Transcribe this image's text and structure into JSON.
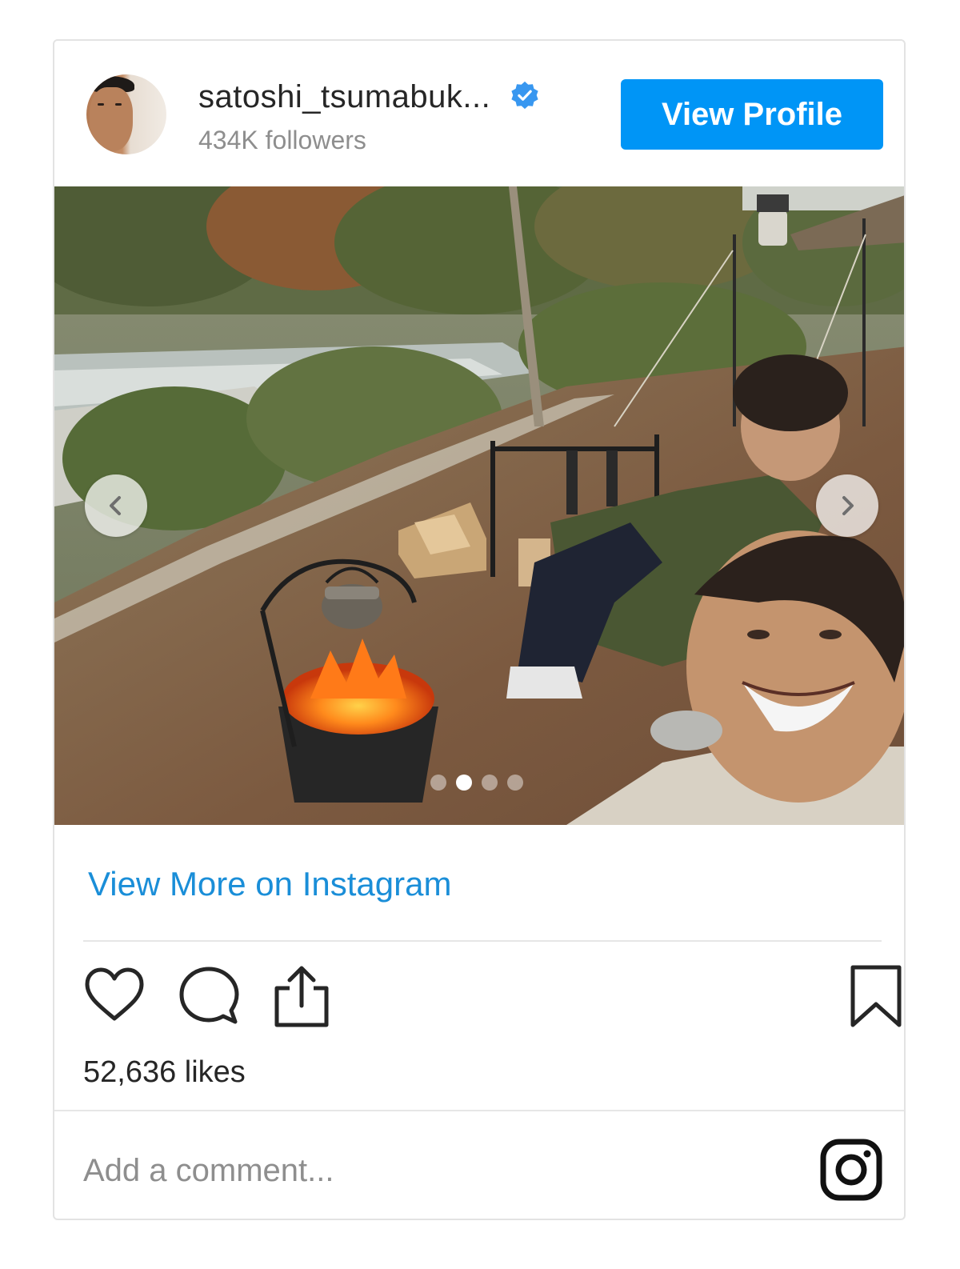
{
  "header": {
    "username": "satoshi_tsumabuk...",
    "followers": "434K followers",
    "view_profile_label": "View Profile",
    "verified_color": "#3897f0"
  },
  "carousel": {
    "slide_count": 4,
    "active_index": 1
  },
  "view_more_label": "View More on Instagram",
  "likes": "52,636 likes",
  "comment": {
    "placeholder": "Add a comment..."
  },
  "icons": {
    "like": "heart-icon",
    "comment": "comment-icon",
    "share": "share-icon",
    "save": "bookmark-icon",
    "brand": "instagram-icon"
  },
  "colors": {
    "accent": "#0095f6",
    "link": "#1a8ed8",
    "muted": "#8e8e8e"
  }
}
